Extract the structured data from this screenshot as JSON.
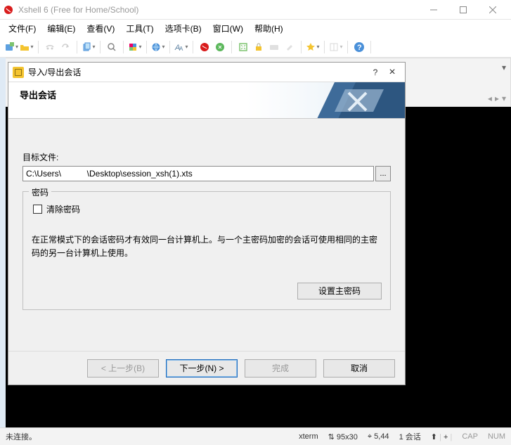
{
  "window": {
    "title": "Xshell 6 (Free for Home/School)"
  },
  "menu": {
    "file": "文件(F)",
    "edit": "编辑(E)",
    "view": "查看(V)",
    "tools": "工具(T)",
    "tabs": "选项卡(B)",
    "window": "窗口(W)",
    "help": "帮助(H)"
  },
  "dialog": {
    "title": "导入/导出会话",
    "banner_title": "导出会话",
    "target_file_label": "目标文件:",
    "target_file_value": "C:\\Users\\           \\Desktop\\session_xsh(1).xts",
    "browse_label": "...",
    "password_legend": "密码",
    "clear_password_label": "清除密码",
    "description": "在正常模式下的会话密码才有效同一台计算机上。与一个主密码加密的会话可使用相同的主密码的另一台计算机上使用。",
    "set_master_password_label": "设置主密码",
    "buttons": {
      "back": "< 上一步(B)",
      "next": "下一步(N) >",
      "finish": "完成",
      "cancel": "取消"
    },
    "help_symbol": "?",
    "close_symbol": "×"
  },
  "statusbar": {
    "status": "未连接。",
    "term": "xterm",
    "size_icon": "⇅",
    "size": "95x30",
    "pos_icon": "⌖",
    "pos": "5,44",
    "sessions": "1 会话",
    "conn_icon": "⬆",
    "plus": "+",
    "cap": "CAP",
    "num": "NUM"
  },
  "colors": {
    "accent": "#1e6bbd",
    "danger": "#d91c1c"
  }
}
